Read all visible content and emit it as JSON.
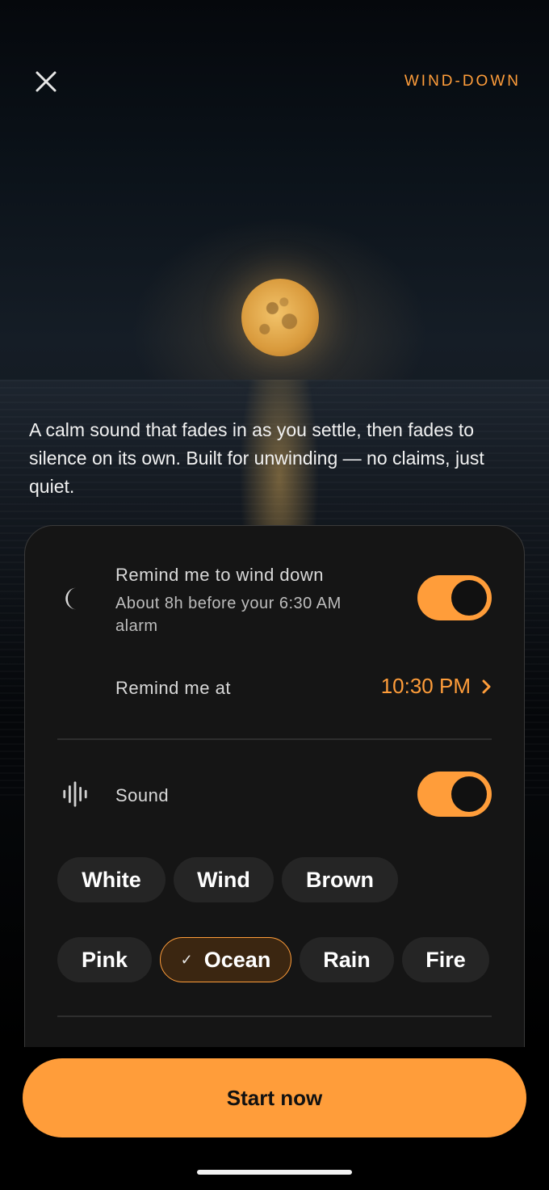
{
  "header": {
    "brand": "WIND-DOWN",
    "close_icon": "close-icon"
  },
  "hero": {
    "description": "A calm sound that fades in as you settle, then fades to silence on its own. Built for unwinding — no claims, just quiet."
  },
  "reminder": {
    "icon": "moon-icon",
    "title": "Remind me to wind down",
    "subtitle_line1": "About 8h before your 6:30 AM",
    "subtitle_line2": "alarm",
    "enabled": true,
    "time_label": "Remind me at",
    "time_value": "10:30 PM"
  },
  "sound": {
    "icon": "waveform-icon",
    "title": "Sound",
    "enabled": true,
    "options": [
      "White",
      "Wind",
      "Brown",
      "Pink",
      "Ocean",
      "Rain",
      "Fire"
    ],
    "selected": "Ocean"
  },
  "cta": {
    "label": "Start now"
  },
  "colors": {
    "accent": "#ff9d3a",
    "card_bg": "#151515",
    "chip_bg": "#252525"
  }
}
